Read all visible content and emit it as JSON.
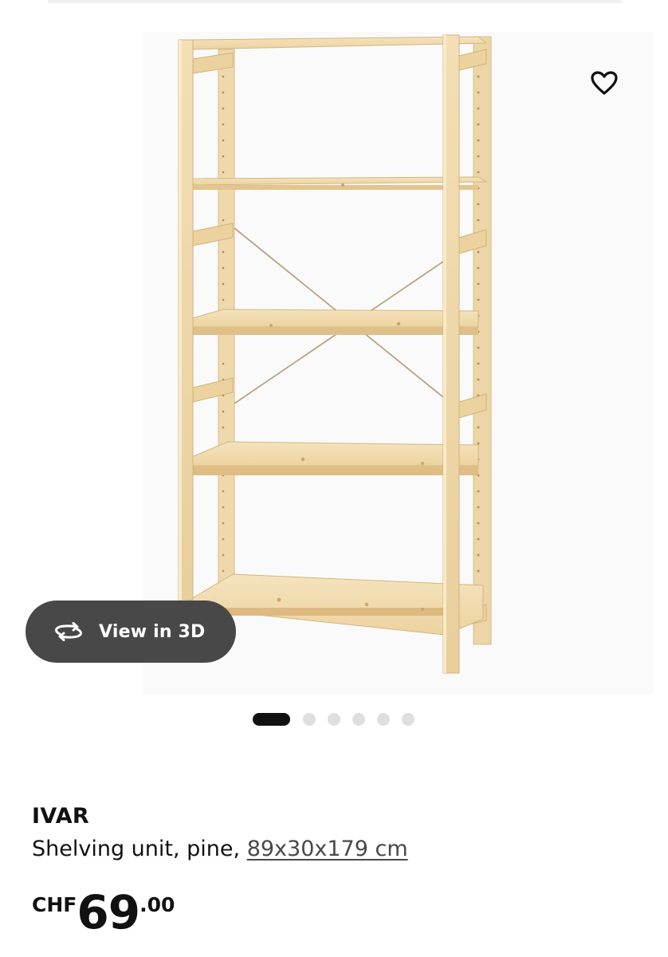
{
  "gallery": {
    "image_subject": "shelving-unit-photo",
    "slide_count": 6,
    "active_slide": 1,
    "view3d_label": "View in 3D",
    "icons": {
      "favourite": "heart-outline-icon",
      "view3d": "rotate-3d-icon"
    }
  },
  "product": {
    "name": "IVAR",
    "description": "Shelving unit, pine, ",
    "size": "89x30x179 cm"
  },
  "price": {
    "currency": "CHF",
    "integer": "69",
    "decimal": ".00"
  },
  "colors": {
    "text": "#111111",
    "button_bg": "#484848",
    "dot_active": "#111111",
    "dot_inactive": "#dfdfdf",
    "wood": "#efd9ad"
  }
}
